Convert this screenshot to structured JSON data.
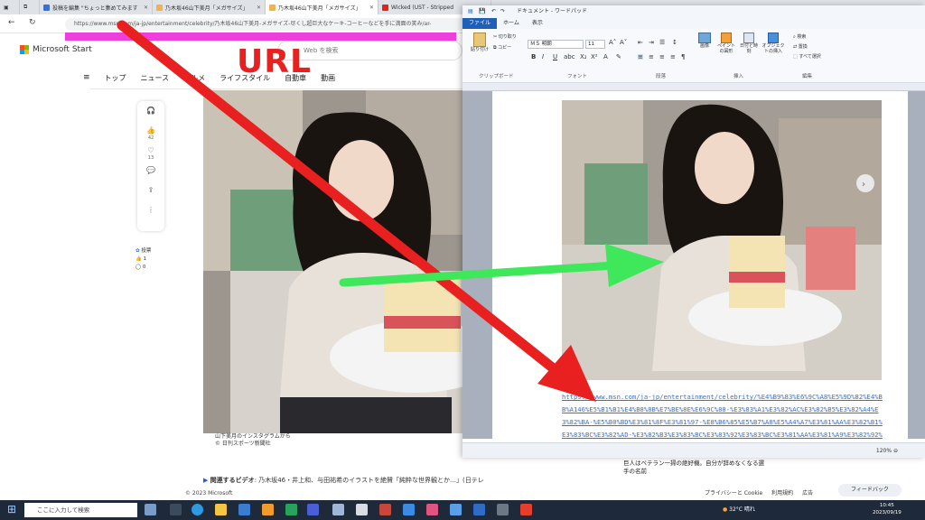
{
  "browser": {
    "tabs": [
      {
        "label": "投稿を編集 \"ちょっと集めてみます",
        "active": false
      },
      {
        "label": "乃木坂46山下美月「メガサイズ」",
        "active": false
      },
      {
        "label": "乃木坂46山下美月「メガサイズ」",
        "active": true
      },
      {
        "label": "Wicked (UST - Stripped",
        "active": false
      }
    ],
    "url": "https://www.msn.com/ja-jp/entertainment/celebrity/乃木坂46山下美月-メガサイズ-尽くし超巨大なケーキ-コーヒーなどを手に満面の笑み/ar-"
  },
  "msstart": {
    "brand": "Microsoft Start",
    "search_placeholder": "Web を検索",
    "nav": [
      "トップ",
      "ニュース",
      "グルメ",
      "ライフスタイル",
      "自動車",
      "動画"
    ],
    "rail": [
      {
        "icon": "headphones-icon",
        "count": ""
      },
      {
        "icon": "like-icon",
        "count": "42"
      },
      {
        "icon": "heart-icon",
        "count": "13"
      },
      {
        "icon": "comment-icon",
        "count": ""
      },
      {
        "icon": "share-icon",
        "count": ""
      },
      {
        "icon": "more-icon",
        "count": ""
      }
    ],
    "side_widget": {
      "title": "投票",
      "count1": "1",
      "count2": "0"
    },
    "caption1": "山下美月のインスタグラムから",
    "caption2": "© 日刊スポーツ新聞社",
    "video_line_label": "関連するビデオ",
    "video_line_text": ": 乃木坂46・井上和、与田祐希のイラストを絶賛「純粋な世界観とか…」(日テレ",
    "copyright": "© 2023 Microsoft",
    "news_snippet": "巨人はベテラン一掃の絶好機。自分が辞めなくなる選手の名前",
    "footer_links": [
      "プライバシーと Cookie",
      "利用規約",
      "広告"
    ],
    "feedback": "フィードバック"
  },
  "wordpad": {
    "title": "ドキュメント - ワードパッド",
    "tabs": [
      "ファイル",
      "ホーム",
      "表示"
    ],
    "clipboard": {
      "paste": "貼り付け",
      "cut": "切り取り",
      "copy": "コピー",
      "group": "クリップボード"
    },
    "font": {
      "name": "ＭＳ 明朝",
      "size": "11",
      "group": "フォント"
    },
    "paragraph_group": "段落",
    "insert": {
      "picture": "画像",
      "paint": "ペイントの図形",
      "datetime": "日付と時刻",
      "object": "オブジェクトの挿入",
      "group": "挿入"
    },
    "edit": {
      "find": "検索",
      "replace": "置換",
      "selectall": "すべて選択",
      "group": "編集"
    },
    "doc_url": "https://www.msn.com/ja-jp/entertainment/celebrity/%E4%B9%83%E6%9C%A8%E5%9D%82%E4%BB%A146%E5%B1%B1%E4%B8%8B%E7%BE%8E%E6%9C%88-%E3%83%A1%E3%82%AC%E3%82%B5%E3%82%A4%E3%82%BA-%E5%B0%BD%E3%81%8F%E3%81%97-%E8%B6%85%E5%B7%A8%E5%A4%A7%E3%81%AA%E3%82%B1%E3%83%BC%E3%82%AD-%E3%82%B3%E3%83%BC%E3%83%92%E3%83%BC%E3%81%AA%E3%81%A9%E3%82%92%E6%89%8B%E3%81%AB%E6%BA%80%E9%9D%A2%E3%81%AE%E7%AC%91%E3%81%BF",
    "zoom": "120%"
  },
  "overlay": {
    "label": "URL"
  },
  "taskbar": {
    "search_placeholder": "ここに入力して検索",
    "weather": "32°C 晴れ",
    "time": "10:45",
    "date": "2023/09/19"
  },
  "colors": {
    "annotation_red": "#e8201f",
    "annotation_green": "#3ee85a",
    "highlight_magenta": "#ee3fdc",
    "wordpad_file_tab": "#1f5fb7"
  }
}
